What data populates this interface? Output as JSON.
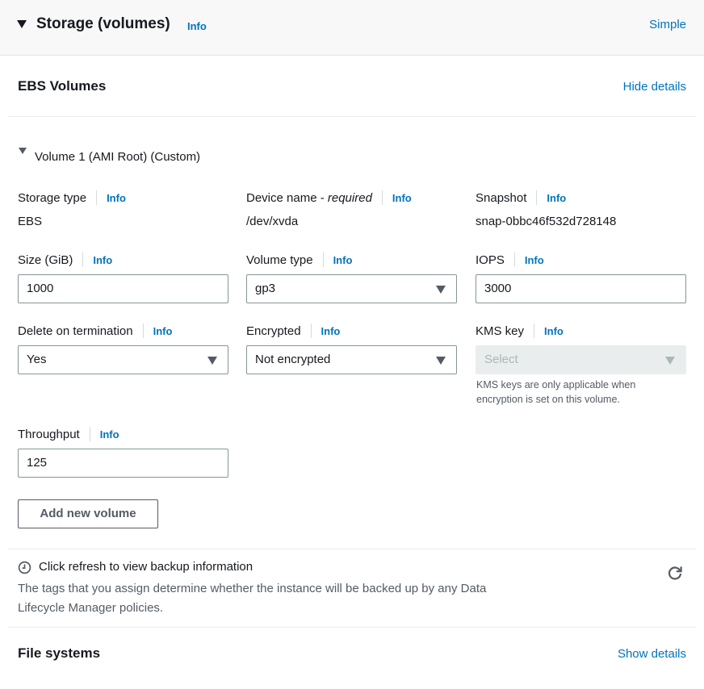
{
  "header": {
    "title": "Storage (volumes)",
    "info": "Info",
    "mode_link": "Simple"
  },
  "ebs": {
    "title": "EBS Volumes",
    "toggle_link": "Hide details"
  },
  "volume": {
    "title": "Volume 1 (AMI Root) (Custom)",
    "fields": {
      "storage_type": {
        "label": "Storage type",
        "info": "Info",
        "value": "EBS"
      },
      "device_name": {
        "label": "Device name - ",
        "label_suffix": "required",
        "info": "Info",
        "value": "/dev/xvda"
      },
      "snapshot": {
        "label": "Snapshot",
        "info": "Info",
        "value": "snap-0bbc46f532d728148"
      },
      "size": {
        "label": "Size (GiB)",
        "info": "Info",
        "value": "1000"
      },
      "volume_type": {
        "label": "Volume type",
        "info": "Info",
        "value": "gp3"
      },
      "iops": {
        "label": "IOPS",
        "info": "Info",
        "value": "3000"
      },
      "delete_on_termination": {
        "label": "Delete on termination",
        "info": "Info",
        "value": "Yes"
      },
      "encrypted": {
        "label": "Encrypted",
        "info": "Info",
        "value": "Not encrypted"
      },
      "kms_key": {
        "label": "KMS key",
        "info": "Info",
        "placeholder": "Select",
        "hint": "KMS keys are only applicable when encryption is set on this volume."
      },
      "throughput": {
        "label": "Throughput",
        "info": "Info",
        "value": "125"
      }
    },
    "add_button": "Add new volume"
  },
  "backup": {
    "icon": "clock-icon",
    "title": "Click refresh to view backup information",
    "description": "The tags that you assign determine whether the instance will be backed up by any Data Lifecycle Manager policies.",
    "refresh_icon": "refresh-icon"
  },
  "file_systems": {
    "title": "File systems",
    "toggle_link": "Show details"
  },
  "colors": {
    "link": "#0073bb",
    "text": "#16191f",
    "secondary_text": "#545b64",
    "header_bg": "#f8f8f8",
    "border": "#879596",
    "disabled_bg": "#eaeded"
  }
}
